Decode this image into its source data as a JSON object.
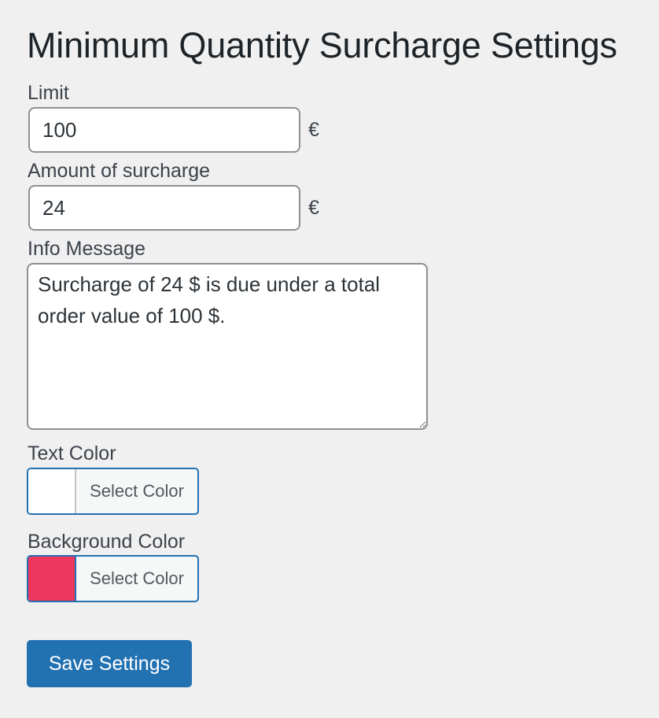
{
  "page_title": "Minimum Quantity Surcharge Settings",
  "limit": {
    "label": "Limit",
    "value": "100",
    "currency": "€"
  },
  "surcharge": {
    "label": "Amount of surcharge",
    "value": "24",
    "currency": "€"
  },
  "info_message": {
    "label": "Info Message",
    "value": "Surcharge of 24 $ is due under a total order value of 100 $."
  },
  "text_color": {
    "label": "Text Color",
    "button_label": "Select Color",
    "color": "#ffffff"
  },
  "background_color": {
    "label": "Background Color",
    "button_label": "Select Color",
    "color": "#ee365e"
  },
  "save_button_label": "Save Settings",
  "colors": {
    "accent": "#2271b1",
    "page_background": "#f0f0f1"
  }
}
